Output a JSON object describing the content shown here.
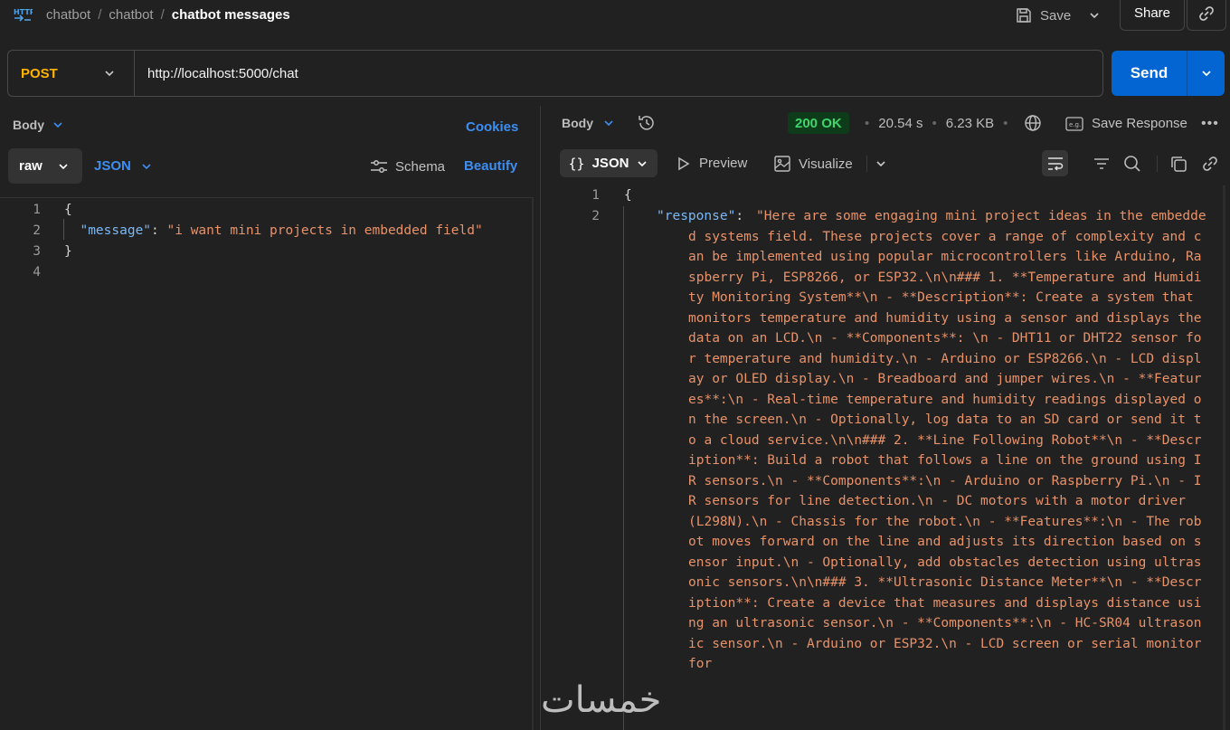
{
  "breadcrumb": {
    "items": [
      "chatbot",
      "chatbot"
    ],
    "current": "chatbot messages"
  },
  "toolbar": {
    "save_label": "Save",
    "share_label": "Share"
  },
  "request": {
    "method": "POST",
    "url": "http://localhost:5000/chat",
    "send_label": "Send"
  },
  "left_panel": {
    "body_tab": "Body",
    "cookies": "Cookies",
    "body_type": "raw",
    "format": "JSON",
    "schema": "Schema",
    "beautify": "Beautify",
    "code": {
      "line_numbers": [
        "1",
        "2",
        "3",
        "4"
      ],
      "open_brace": "{",
      "key": "\"message\"",
      "colon": ": ",
      "value": "\"i want mini projects in embedded field\"",
      "close_brace": "}"
    }
  },
  "response_panel": {
    "body_tab": "Body",
    "status": "200 OK",
    "time": "20.54 s",
    "size": "6.23 KB",
    "save_response": "Save Response",
    "view_format": "JSON",
    "preview": "Preview",
    "visualize": "Visualize",
    "code": {
      "line_numbers": [
        "1",
        "2"
      ],
      "open_brace": "{",
      "key": "\"response\"",
      "colon": ": ",
      "value": "\"Here are some engaging mini project ideas in the embedded systems field. These projects cover a range of complexity and can be implemented using popular microcontrollers like Arduino, Raspberry Pi, ESP8266, or ESP32.\\n\\n### 1. **Temperature and Humidity Monitoring System**\\n - **Description**: Create a system that monitors temperature and humidity using a sensor and displays the data on an LCD.\\n - **Components**: \\n - DHT11 or DHT22 sensor for temperature and humidity.\\n - Arduino or ESP8266.\\n - LCD display or OLED display.\\n - Breadboard and jumper wires.\\n - **Features**:\\n - Real-time temperature and humidity readings displayed on the screen.\\n - Optionally, log data to an SD card or send it to a cloud service.\\n\\n### 2. **Line Following Robot**\\n - **Description**: Build a robot that follows a line on the ground using IR sensors.\\n - **Components**:\\n - Arduino or Raspberry Pi.\\n - IR sensors for line detection.\\n - DC motors with a motor driver (L298N).\\n - Chassis for the robot.\\n - **Features**:\\n - The robot moves forward on the line and adjusts its direction based on sensor input.\\n - Optionally, add obstacles detection using ultrasonic sensors.\\n\\n### 3. **Ultrasonic Distance Meter**\\n - **Description**: Create a device that measures and displays distance using an ultrasonic sensor.\\n - **Components**:\\n - HC-SR04 ultrasonic sensor.\\n - Arduino or ESP32.\\n - LCD screen or serial monitor for"
    }
  },
  "watermark": "خمسات"
}
